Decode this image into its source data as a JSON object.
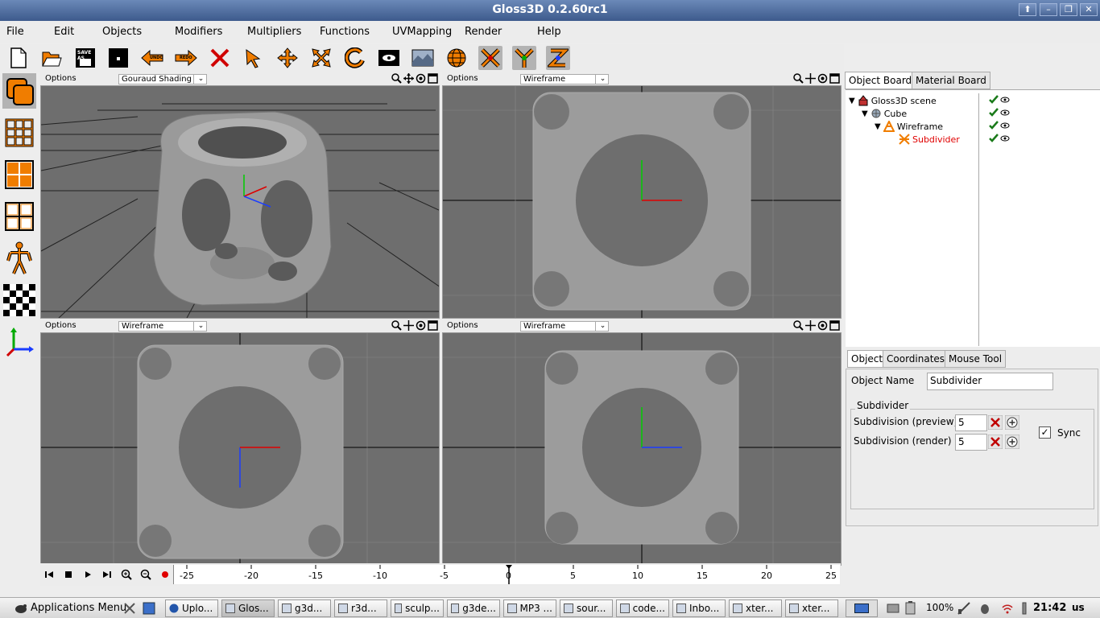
{
  "window": {
    "title": "Gloss3D 0.2.60rc1",
    "btn_up": "⬆",
    "btn_min": "–",
    "btn_max": "❐",
    "btn_close": "✕"
  },
  "menu": [
    "File",
    "Edit",
    "Objects",
    "Modifiers",
    "Multipliers",
    "Functions",
    "UVMapping",
    "Render",
    "Help"
  ],
  "toolbar": {
    "save_label": "SAVE AS",
    "undo_label": "UNDO",
    "redo_label": "REDO",
    "axis_z_label": "Z"
  },
  "viewports": [
    {
      "options": "Options",
      "shading": "Gouraud Shading",
      "dropdown": "⌄"
    },
    {
      "options": "Options",
      "shading": "Wireframe",
      "dropdown": "⌄"
    },
    {
      "options": "Options",
      "shading": "Wireframe",
      "dropdown": "⌄"
    },
    {
      "options": "Options",
      "shading": "Wireframe",
      "dropdown": "⌄"
    }
  ],
  "timeline": {
    "ticks": [
      "-25",
      "-20",
      "-15",
      "-10",
      "-5",
      "0",
      "5",
      "10",
      "15",
      "20",
      "25"
    ]
  },
  "board_tabs": [
    "Object Board",
    "Material Board"
  ],
  "tree": [
    {
      "label": "Gloss3D scene",
      "expander": "▼"
    },
    {
      "label": "Cube",
      "expander": "▼"
    },
    {
      "label": "Wireframe",
      "expander": "▼"
    },
    {
      "label": "Subdivider",
      "expander": ""
    }
  ],
  "prop_tabs": [
    "Object",
    "Coordinates",
    "Mouse Tool"
  ],
  "object": {
    "name_label": "Object Name",
    "name_value": "Subdivider",
    "group_label": "Subdivider",
    "preview_label": "Subdivision (preview)",
    "preview_value": "5",
    "render_label": "Subdivision (render)",
    "render_value": "5",
    "sync_label": "Sync",
    "sync_mark": "✓"
  },
  "taskbar": {
    "apps_menu": "Applications Menu",
    "tasks": [
      "Uplo...",
      "Glos...",
      "g3d...",
      "r3d...",
      "sculp...",
      "g3de...",
      "MP3 ...",
      "sour...",
      "code...",
      "Inbo...",
      "xter...",
      "xter..."
    ],
    "battery": "100%",
    "clock": "21:42",
    "keyboard": "us"
  },
  "colors": {
    "accent": "#f07d00",
    "title_bar": "#4a6797",
    "viewport_bg": "#6e6e6e",
    "selected_object": "#e00000"
  }
}
